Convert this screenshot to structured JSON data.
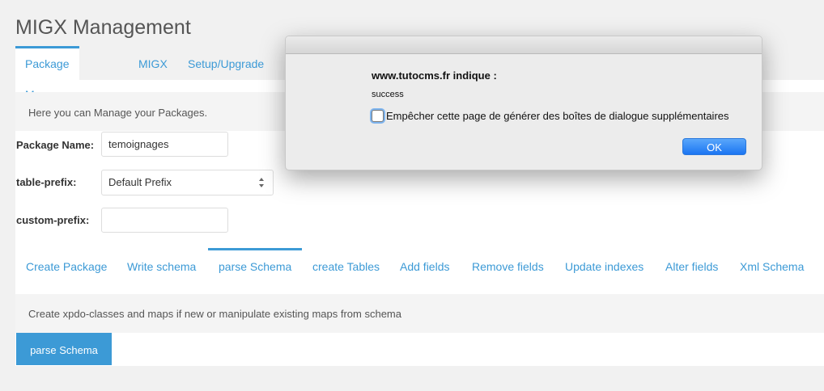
{
  "page": {
    "title": "MIGX Management"
  },
  "top_tabs": [
    {
      "label": "Package Manager",
      "active": true
    },
    {
      "label": "MIGX",
      "active": false
    },
    {
      "label": "Setup/Upgrade",
      "active": false
    }
  ],
  "intro": {
    "text": "Here you can Manage your Packages."
  },
  "form": {
    "package_name": {
      "label": "Package Name:",
      "value": "temoignages"
    },
    "table_prefix": {
      "label": "table-prefix:",
      "value": "Default Prefix"
    },
    "custom_prefix": {
      "label": "custom-prefix:",
      "value": ""
    }
  },
  "sub_tabs": [
    {
      "label": "Create Package",
      "active": false
    },
    {
      "label": "Write schema",
      "active": false
    },
    {
      "label": "parse Schema",
      "active": true
    },
    {
      "label": "create Tables",
      "active": false
    },
    {
      "label": "Add fields",
      "active": false
    },
    {
      "label": "Remove fields",
      "active": false
    },
    {
      "label": "Update indexes",
      "active": false
    },
    {
      "label": "Alter fields",
      "active": false
    },
    {
      "label": "Xml Schema",
      "active": false
    }
  ],
  "section": {
    "description": "Create xpdo-classes and maps if new or manipulate existing maps from schema",
    "button_label": "parse Schema"
  },
  "dialog": {
    "heading": "www.tutocms.fr indique :",
    "message": "success",
    "checkbox_label": "Empêcher cette page de générer des boîtes de dialogue supplémentaires",
    "checkbox_checked": false,
    "ok_label": "OK"
  },
  "colors": {
    "accent": "#3c9ad6",
    "ok_button": "#1b75f2"
  }
}
